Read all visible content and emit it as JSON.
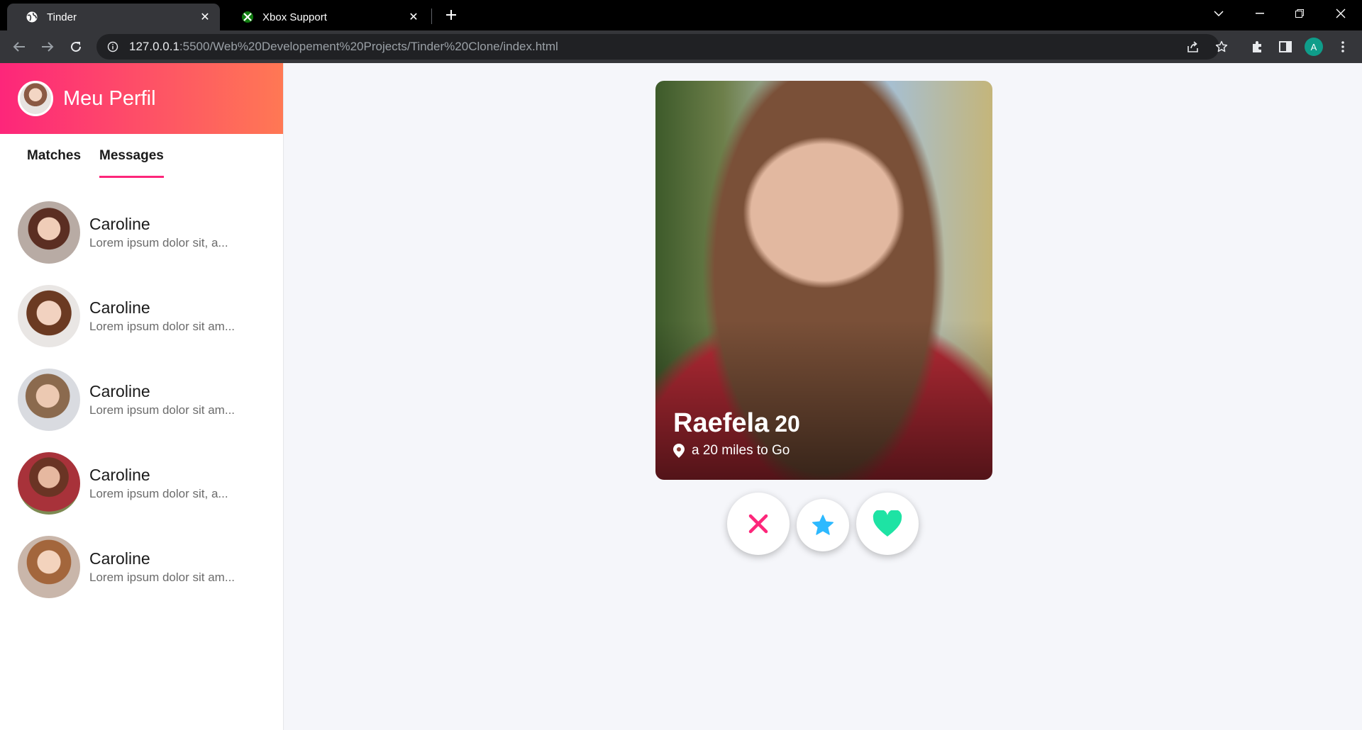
{
  "browser": {
    "tabs": [
      {
        "title": "Tinder",
        "icon": "globe-icon",
        "active": true
      },
      {
        "title": "Xbox Support",
        "icon": "xbox-icon",
        "active": false
      }
    ],
    "url": {
      "host": "127.0.0.1",
      "path": ":5500/Web%20Developement%20Projects/Tinder%20Clone/index.html"
    },
    "profile_initial": "A"
  },
  "sidebar": {
    "title": "Meu Perfil",
    "tabs": [
      {
        "label": "Matches",
        "active": false
      },
      {
        "label": "Messages",
        "active": true
      }
    ],
    "messages": [
      {
        "name": "Caroline",
        "preview": "Lorem ipsum dolor sit, a..."
      },
      {
        "name": "Caroline",
        "preview": "Lorem ipsum dolor sit am..."
      },
      {
        "name": "Caroline",
        "preview": "Lorem ipsum dolor sit am..."
      },
      {
        "name": "Caroline",
        "preview": "Lorem ipsum dolor sit, a..."
      },
      {
        "name": "Caroline",
        "preview": "Lorem ipsum dolor sit am..."
      }
    ]
  },
  "card": {
    "name": "Raefela",
    "age": "20",
    "location": "a 20 miles to Go"
  },
  "colors": {
    "brand_gradient_start": "#fd267a",
    "brand_gradient_end": "#ff7854",
    "nope": "#fd267a",
    "super_like": "#2db9ff",
    "like": "#1ee3a4"
  }
}
